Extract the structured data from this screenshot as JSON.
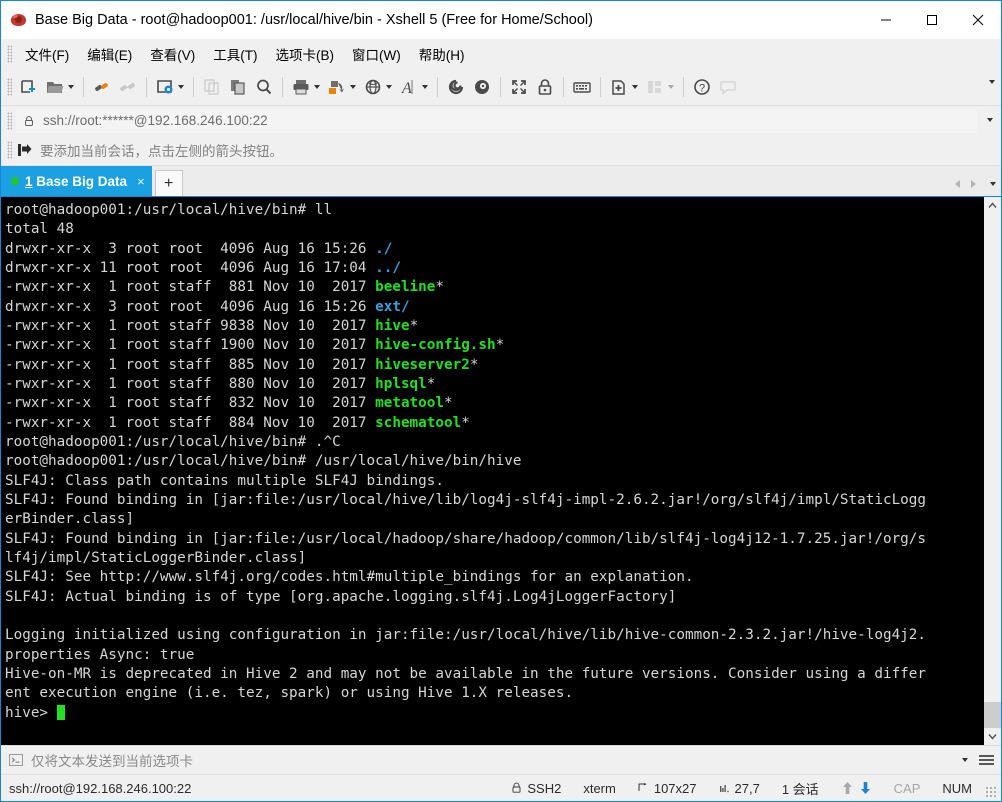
{
  "window": {
    "title": "Base Big Data - root@hadoop001: /usr/local/hive/bin - Xshell 5 (Free for Home/School)",
    "app_icon": "xshell-icon",
    "minimize_label": "Minimize",
    "maximize_label": "Maximize",
    "close_label": "Close"
  },
  "menubar": {
    "items": [
      {
        "label": "文件(F)",
        "name": "menu-file"
      },
      {
        "label": "编辑(E)",
        "name": "menu-edit"
      },
      {
        "label": "查看(V)",
        "name": "menu-view"
      },
      {
        "label": "工具(T)",
        "name": "menu-tools"
      },
      {
        "label": "选项卡(B)",
        "name": "menu-tabs"
      },
      {
        "label": "窗口(W)",
        "name": "menu-window"
      },
      {
        "label": "帮助(H)",
        "name": "menu-help"
      }
    ]
  },
  "toolbar": {
    "buttons": [
      {
        "name": "new-session-icon",
        "title": "新建会话"
      },
      {
        "name": "open-folder-icon",
        "title": "打开"
      },
      {
        "name": "connect-icon",
        "title": "连接"
      },
      {
        "name": "disconnect-icon",
        "title": "断开"
      },
      {
        "name": "session-properties-icon",
        "title": "属性"
      },
      {
        "name": "copy-session-icon",
        "title": "复制会话"
      },
      {
        "name": "paste-icon",
        "title": "粘贴"
      },
      {
        "name": "find-icon",
        "title": "查找"
      },
      {
        "name": "print-icon",
        "title": "打印"
      },
      {
        "name": "file-transfer-icon",
        "title": "文件传输"
      },
      {
        "name": "globe-icon",
        "title": "编码"
      },
      {
        "name": "font-icon",
        "title": "字体"
      },
      {
        "name": "xftp-icon",
        "title": "Xftp"
      },
      {
        "name": "xagent-icon",
        "title": "Xagent"
      },
      {
        "name": "fullscreen-icon",
        "title": "全屏"
      },
      {
        "name": "lock-icon",
        "title": "锁定"
      },
      {
        "name": "keyboard-icon",
        "title": "键盘"
      },
      {
        "name": "add-layout-icon",
        "title": "新建布局"
      },
      {
        "name": "arrange-icon",
        "title": "排列"
      },
      {
        "name": "help-icon",
        "title": "帮助"
      },
      {
        "name": "comment-icon",
        "title": "备注"
      }
    ],
    "overflow_label": "更多"
  },
  "address": {
    "lock_icon": "lock-icon",
    "value": "ssh://root:******@192.168.246.100:22",
    "dropdown_label": "历史"
  },
  "notice": {
    "icon": "add-session-icon",
    "text": "要添加当前会话，点击左侧的箭头按钮。"
  },
  "tabs": {
    "items": [
      {
        "number": "1",
        "title": "Base Big Data",
        "status_dot": "connected-dot",
        "close_label": "×",
        "active": true
      }
    ],
    "new_tab_label": "+",
    "nav_prev_label": "◀",
    "nav_next_label": "▶",
    "nav_list_label": "▾"
  },
  "terminal": {
    "colors": {
      "background": "#000000",
      "foreground": "#d6d6d6",
      "executable": "#21e021",
      "directory": "#3b9dd8",
      "cursor": "#21e021"
    },
    "cursor_visible": true,
    "lines": [
      {
        "segments": [
          {
            "t": "root@hadoop001:/usr/local/hive/bin# ll",
            "c": "white"
          }
        ]
      },
      {
        "segments": [
          {
            "t": "total 48",
            "c": "white"
          }
        ]
      },
      {
        "segments": [
          {
            "t": "drwxr-xr-x  3 root root  4096 Aug 16 15:26 ",
            "c": "white"
          },
          {
            "t": "./",
            "c": "blue"
          }
        ]
      },
      {
        "segments": [
          {
            "t": "drwxr-xr-x 11 root root  4096 Aug 16 17:04 ",
            "c": "white"
          },
          {
            "t": "../",
            "c": "blue"
          }
        ]
      },
      {
        "segments": [
          {
            "t": "-rwxr-xr-x  1 root staff  881 Nov 10  2017 ",
            "c": "white"
          },
          {
            "t": "beeline",
            "c": "green"
          },
          {
            "t": "*",
            "c": "white"
          }
        ]
      },
      {
        "segments": [
          {
            "t": "drwxr-xr-x  3 root root  4096 Aug 16 15:26 ",
            "c": "white"
          },
          {
            "t": "ext/",
            "c": "blue"
          }
        ]
      },
      {
        "segments": [
          {
            "t": "-rwxr-xr-x  1 root staff 9838 Nov 10  2017 ",
            "c": "white"
          },
          {
            "t": "hive",
            "c": "green"
          },
          {
            "t": "*",
            "c": "white"
          }
        ]
      },
      {
        "segments": [
          {
            "t": "-rwxr-xr-x  1 root staff 1900 Nov 10  2017 ",
            "c": "white"
          },
          {
            "t": "hive-config.sh",
            "c": "green"
          },
          {
            "t": "*",
            "c": "white"
          }
        ]
      },
      {
        "segments": [
          {
            "t": "-rwxr-xr-x  1 root staff  885 Nov 10  2017 ",
            "c": "white"
          },
          {
            "t": "hiveserver2",
            "c": "green"
          },
          {
            "t": "*",
            "c": "white"
          }
        ]
      },
      {
        "segments": [
          {
            "t": "-rwxr-xr-x  1 root staff  880 Nov 10  2017 ",
            "c": "white"
          },
          {
            "t": "hplsql",
            "c": "green"
          },
          {
            "t": "*",
            "c": "white"
          }
        ]
      },
      {
        "segments": [
          {
            "t": "-rwxr-xr-x  1 root staff  832 Nov 10  2017 ",
            "c": "white"
          },
          {
            "t": "metatool",
            "c": "green"
          },
          {
            "t": "*",
            "c": "white"
          }
        ]
      },
      {
        "segments": [
          {
            "t": "-rwxr-xr-x  1 root staff  884 Nov 10  2017 ",
            "c": "white"
          },
          {
            "t": "schematool",
            "c": "green"
          },
          {
            "t": "*",
            "c": "white"
          }
        ]
      },
      {
        "segments": [
          {
            "t": "root@hadoop001:/usr/local/hive/bin# .^C",
            "c": "white"
          }
        ]
      },
      {
        "segments": [
          {
            "t": "root@hadoop001:/usr/local/hive/bin# /usr/local/hive/bin/hive",
            "c": "white"
          }
        ]
      },
      {
        "segments": [
          {
            "t": "SLF4J: Class path contains multiple SLF4J bindings.",
            "c": "white"
          }
        ]
      },
      {
        "segments": [
          {
            "t": "SLF4J: Found binding in [jar:file:/usr/local/hive/lib/log4j-slf4j-impl-2.6.2.jar!/org/slf4j/impl/StaticLogg",
            "c": "white"
          }
        ]
      },
      {
        "segments": [
          {
            "t": "erBinder.class]",
            "c": "white"
          }
        ]
      },
      {
        "segments": [
          {
            "t": "SLF4J: Found binding in [jar:file:/usr/local/hadoop/share/hadoop/common/lib/slf4j-log4j12-1.7.25.jar!/org/s",
            "c": "white"
          }
        ]
      },
      {
        "segments": [
          {
            "t": "lf4j/impl/StaticLoggerBinder.class]",
            "c": "white"
          }
        ]
      },
      {
        "segments": [
          {
            "t": "SLF4J: See http://www.slf4j.org/codes.html#multiple_bindings for an explanation.",
            "c": "white"
          }
        ]
      },
      {
        "segments": [
          {
            "t": "SLF4J: Actual binding is of type [org.apache.logging.slf4j.Log4jLoggerFactory]",
            "c": "white"
          }
        ]
      },
      {
        "segments": [
          {
            "t": "",
            "c": "white"
          }
        ]
      },
      {
        "segments": [
          {
            "t": "Logging initialized using configuration in jar:file:/usr/local/hive/lib/hive-common-2.3.2.jar!/hive-log4j2.",
            "c": "white"
          }
        ]
      },
      {
        "segments": [
          {
            "t": "properties Async: true",
            "c": "white"
          }
        ]
      },
      {
        "segments": [
          {
            "t": "Hive-on-MR is deprecated in Hive 2 and may not be available in the future versions. Consider using a differ",
            "c": "white"
          }
        ]
      },
      {
        "segments": [
          {
            "t": "ent execution engine (i.e. tez, spark) or using Hive 1.X releases.",
            "c": "white"
          }
        ]
      },
      {
        "segments": [
          {
            "t": "hive> ",
            "c": "white"
          }
        ],
        "cursor": true
      }
    ]
  },
  "sendbar": {
    "icon": "terminal-prompt-icon",
    "text": "仅将文本发送到当前选项卡",
    "dropdown_label": "▾",
    "menu_label": "≡"
  },
  "statusbar": {
    "connection": "ssh://root@192.168.246.100:22",
    "protocol": "SSH2",
    "terminal_type": "xterm",
    "size": "107x27",
    "cursor_position": "27,7",
    "sessions": "1 会话",
    "upload_icon": "upload-arrow-icon",
    "download_icon": "download-arrow-icon",
    "caps_lock": "CAP",
    "num_lock": "NUM"
  }
}
